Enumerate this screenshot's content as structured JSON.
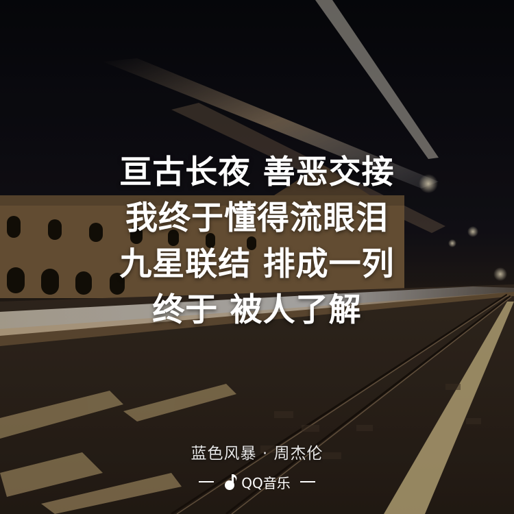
{
  "lyrics": {
    "lines": [
      "亘古长夜 善恶交接",
      "我终于懂得流眼泪",
      "九星联结 排成一列",
      "终于 被人了解"
    ]
  },
  "song": {
    "credit": "蓝色风暴 · 周杰伦"
  },
  "brand": {
    "name": "QQ音乐",
    "icon": "music-note-icon"
  },
  "colors": {
    "text": "#ffffff",
    "sky": "#0a0b10",
    "streak": "#d9a86a"
  }
}
